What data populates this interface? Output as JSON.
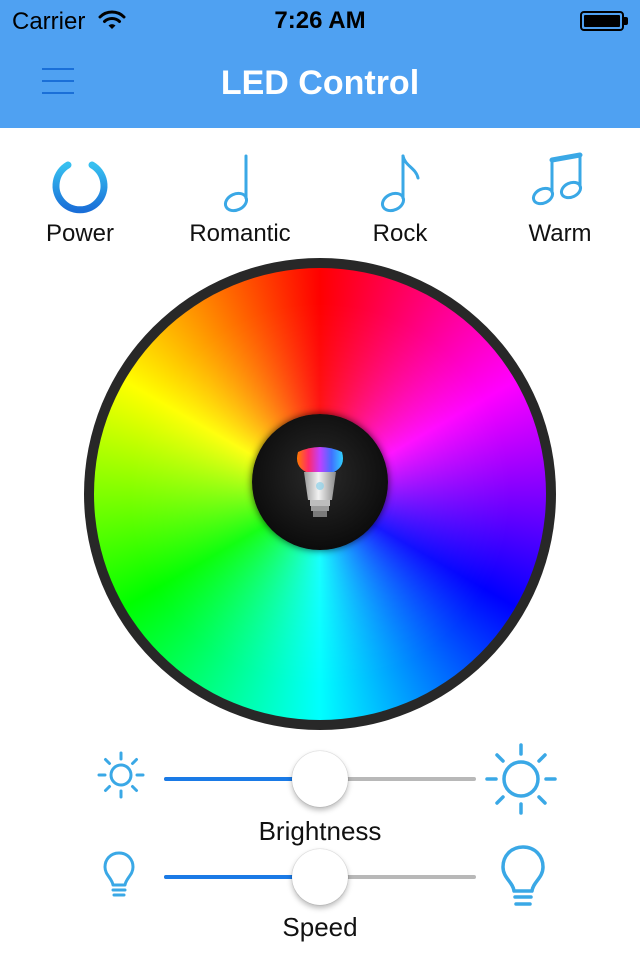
{
  "status_bar": {
    "carrier": "Carrier",
    "time": "7:26 AM",
    "battery_level": 1.0,
    "icons": [
      "wifi-icon",
      "battery-icon"
    ]
  },
  "nav": {
    "title": "LED Control",
    "menu_icon": "hamburger-menu-icon"
  },
  "modes": [
    {
      "label": "Power",
      "icon": "power-icon"
    },
    {
      "label": "Romantic",
      "icon": "single-note-icon"
    },
    {
      "label": "Rock",
      "icon": "eighth-note-icon"
    },
    {
      "label": "Warm",
      "icon": "double-note-icon"
    }
  ],
  "color_wheel": {
    "center_icon": "light-bulb-icon",
    "spectrum": [
      "#ff0000",
      "#ff00ff",
      "#0000ff",
      "#00ffff",
      "#00ff00",
      "#ffff00"
    ]
  },
  "brightness": {
    "label": "Brightness",
    "value": 0.5,
    "min_icon": "sun-small-icon",
    "max_icon": "sun-large-icon"
  },
  "speed": {
    "label": "Speed",
    "value": 0.5,
    "min_icon": "bulb-small-icon",
    "max_icon": "bulb-large-icon"
  },
  "colors": {
    "nav_bar": "#4fa1f2",
    "accent": "#1a7ae6",
    "icon_blue": "#3aa8e6",
    "track": "#b8b8b8"
  }
}
